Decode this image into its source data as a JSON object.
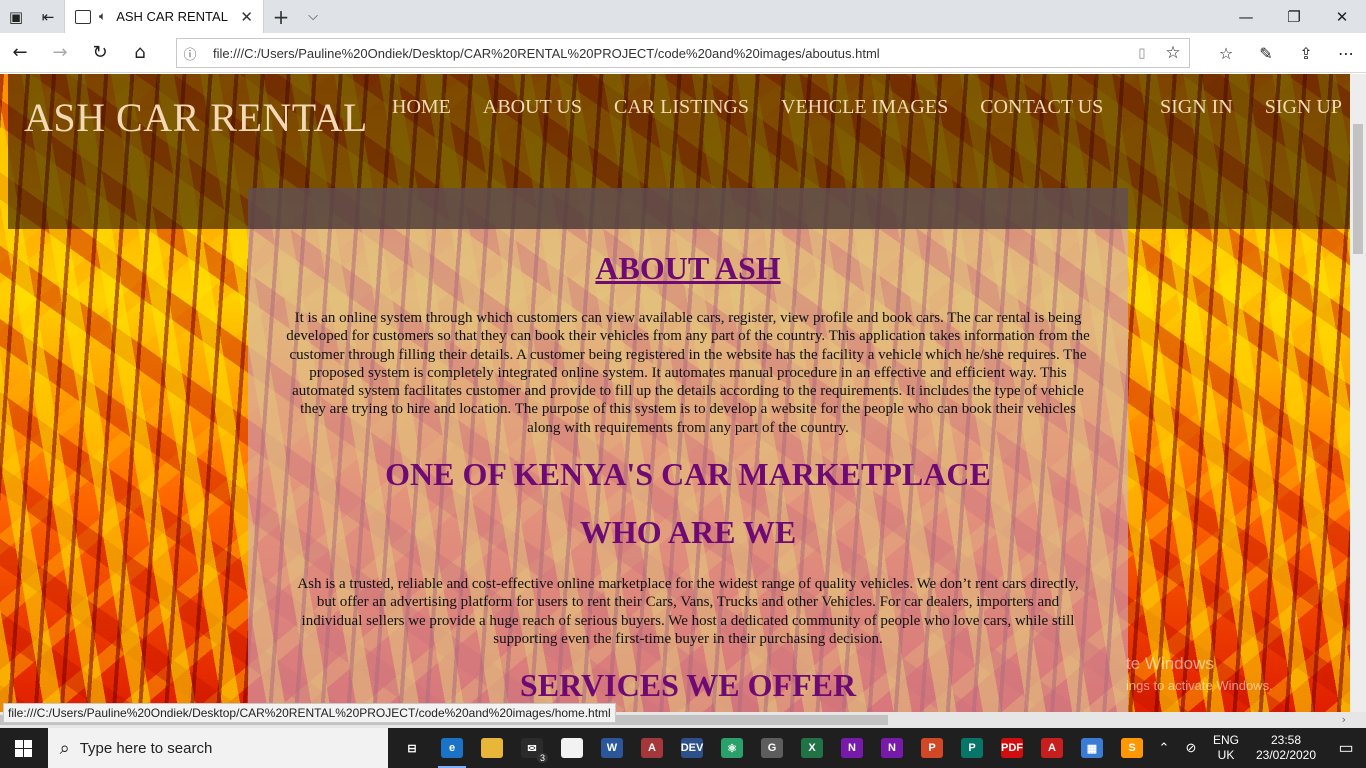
{
  "browser": {
    "tab_title": "ASH CAR RENTAL",
    "address_url": "file:///C:/Users/Pauline%20Ondiek/Desktop/CAR%20RENTAL%20PROJECT/code%20and%20images/aboutus.html",
    "status_url": "file:///C:/Users/Pauline%20Ondiek/Desktop/CAR%20RENTAL%20PROJECT/code%20and%20images/home.html"
  },
  "site": {
    "brand": "ASH CAR RENTAL",
    "nav": [
      "HOME",
      "ABOUT US",
      "CAR LISTINGS",
      "VEHICLE IMAGES",
      "CONTACT US"
    ],
    "auth": [
      "SIGN IN",
      "SIGN UP"
    ]
  },
  "content": {
    "title": "ABOUT ASH",
    "about_text": "It is an online system through which customers can view available cars, register, view profile and book cars. The car rental is being developed for customers so that they can book their vehicles from any part of the country. This application takes information from the customer through filling their details. A customer being registered in the website has the facility a vehicle which he/she requires. The proposed system is completely integrated online system. It automates manual procedure in an effective and efficient way. This automated system facilitates customer and provide to fill up the details according to the requirements. It includes the type of vehicle they are trying to hire and location. The purpose of this system is to develop a website for the people who can book their vehicles along with requirements from any part of the country.",
    "heading_marketplace": "ONE OF KENYA'S CAR MARKETPLACE",
    "heading_who": "WHO ARE WE",
    "who_text": "Ash is a trusted, reliable and cost-effective online marketplace for the widest range of quality vehicles. We don’t rent cars directly, but offer an advertising platform for users to rent their Cars, Vans, Trucks and other Vehicles. For car dealers, importers and individual sellers we provide a huge reach of serious buyers. We host a dedicated community of people who love cars, while still supporting even the first-time buyer in their purchasing decision.",
    "heading_services": "SERVICES WE OFFER"
  },
  "watermark": {
    "line1": "te Windows",
    "line2": "ings to activate Windows."
  },
  "taskbar": {
    "search_placeholder": "Type here to search",
    "mail_badge": "3",
    "lang_top": "ENG",
    "lang_bottom": "UK",
    "time": "23:58",
    "date": "23/02/2020",
    "apps": [
      {
        "name": "task-view-icon",
        "color": "#1f1f1f",
        "label": "⊟"
      },
      {
        "name": "edge-icon",
        "color": "#1a73c7",
        "label": "e"
      },
      {
        "name": "file-explorer-icon",
        "color": "#e8b73a",
        "label": ""
      },
      {
        "name": "mail-icon",
        "color": "#2b2b2b",
        "label": "✉"
      },
      {
        "name": "store-icon",
        "color": "#f2f2f2",
        "label": ""
      },
      {
        "name": "word-icon",
        "color": "#2b579a",
        "label": "W"
      },
      {
        "name": "access-icon",
        "color": "#a4373a",
        "label": "A"
      },
      {
        "name": "devcpp-icon",
        "color": "#2d4f8c",
        "label": "DEV"
      },
      {
        "name": "atom-icon",
        "color": "#2aa06a",
        "label": "⚛"
      },
      {
        "name": "gimp-icon",
        "color": "#5d5d5d",
        "label": "G"
      },
      {
        "name": "excel-icon",
        "color": "#217346",
        "label": "X"
      },
      {
        "name": "onenote-icon",
        "color": "#7719aa",
        "label": "N"
      },
      {
        "name": "onenote2-icon",
        "color": "#7719aa",
        "label": "N"
      },
      {
        "name": "powerpoint-icon",
        "color": "#d24726",
        "label": "P"
      },
      {
        "name": "publisher-icon",
        "color": "#077568",
        "label": "P"
      },
      {
        "name": "pdf-reader-icon",
        "color": "#d10d0d",
        "label": "PDF"
      },
      {
        "name": "acrobat-icon",
        "color": "#c81e1e",
        "label": "A"
      },
      {
        "name": "network-tool-icon",
        "color": "#3a7bd5",
        "label": "▦"
      },
      {
        "name": "sublime-icon",
        "color": "#ff9800",
        "label": "S"
      }
    ]
  }
}
